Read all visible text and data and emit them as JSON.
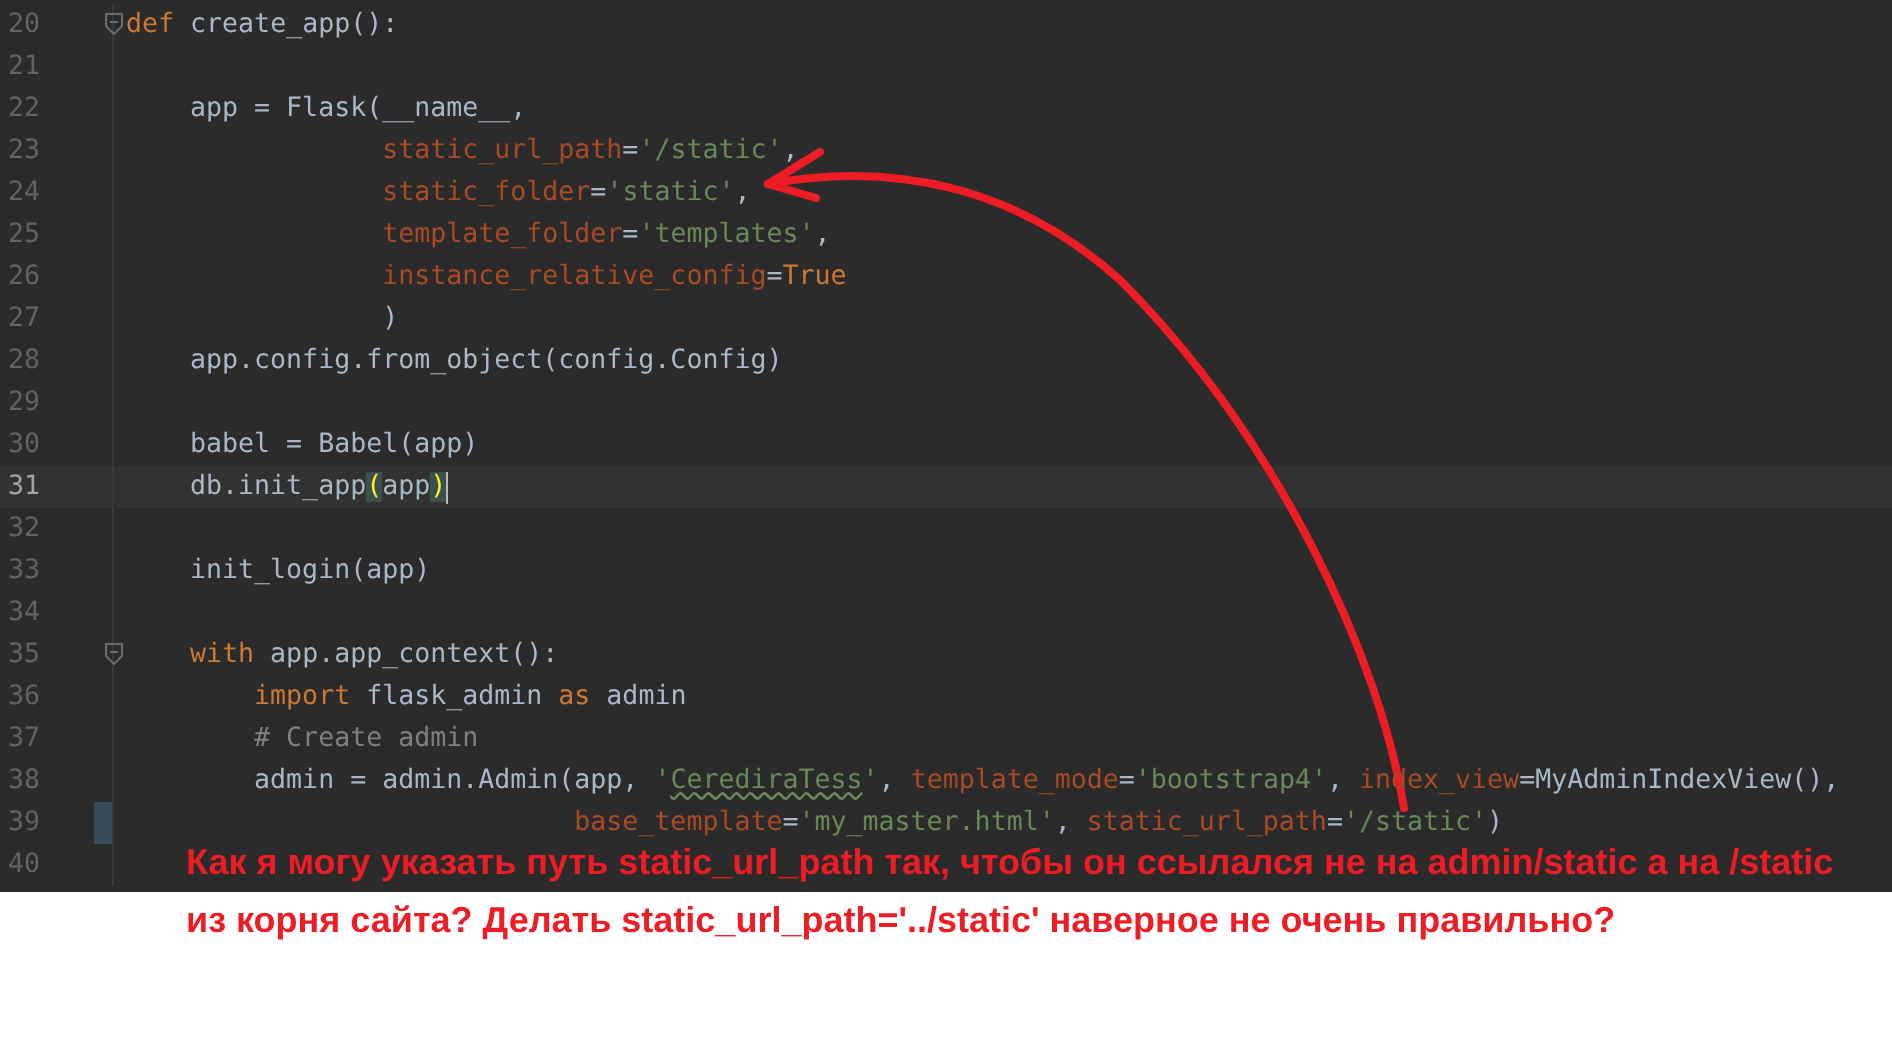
{
  "editor": {
    "lines": [
      {
        "number": "20",
        "fold": true,
        "current": false,
        "changed": false,
        "caret": false,
        "tokens": [
          {
            "text": "def",
            "kind": "keyword"
          },
          {
            "text": " create_app():",
            "kind": "plain"
          }
        ]
      },
      {
        "number": "21",
        "fold": false,
        "current": false,
        "changed": false,
        "caret": false
      },
      {
        "number": "22",
        "fold": false,
        "current": false,
        "changed": false,
        "caret": false,
        "tokens": [
          {
            "text": "    app = Flask(__name__,",
            "kind": "plain"
          }
        ]
      },
      {
        "number": "23",
        "fold": false,
        "current": false,
        "changed": false,
        "caret": false,
        "tokens": [
          {
            "text": "                static_url_path",
            "kind": "param"
          },
          {
            "text": "=",
            "kind": "plain"
          },
          {
            "text": "'/static'",
            "kind": "string"
          },
          {
            "text": ",",
            "kind": "plain"
          }
        ]
      },
      {
        "number": "24",
        "fold": false,
        "current": false,
        "changed": false,
        "caret": false,
        "tokens": [
          {
            "text": "                static_folder",
            "kind": "param"
          },
          {
            "text": "=",
            "kind": "plain"
          },
          {
            "text": "'static'",
            "kind": "string"
          },
          {
            "text": ",",
            "kind": "plain"
          }
        ]
      },
      {
        "number": "25",
        "fold": false,
        "current": false,
        "changed": false,
        "caret": false,
        "tokens": [
          {
            "text": "                template_folder",
            "kind": "param"
          },
          {
            "text": "=",
            "kind": "plain"
          },
          {
            "text": "'templates'",
            "kind": "string"
          },
          {
            "text": ",",
            "kind": "plain"
          }
        ]
      },
      {
        "number": "26",
        "fold": false,
        "current": false,
        "changed": false,
        "caret": false,
        "tokens": [
          {
            "text": "                instance_relative_config",
            "kind": "param"
          },
          {
            "text": "=",
            "kind": "plain"
          },
          {
            "text": "True",
            "kind": "keyword"
          }
        ]
      },
      {
        "number": "27",
        "fold": false,
        "current": false,
        "changed": false,
        "caret": false,
        "tokens": [
          {
            "text": "                )",
            "kind": "plain"
          }
        ]
      },
      {
        "number": "28",
        "fold": false,
        "current": false,
        "changed": false,
        "caret": false,
        "tokens": [
          {
            "text": "    app.config.from_object(config.Config)",
            "kind": "plain"
          }
        ]
      },
      {
        "number": "29",
        "fold": false,
        "current": false,
        "changed": false,
        "caret": false
      },
      {
        "number": "30",
        "fold": false,
        "current": false,
        "changed": false,
        "caret": false,
        "tokens": [
          {
            "text": "    babel = Babel(app)",
            "kind": "plain"
          }
        ]
      },
      {
        "number": "31",
        "fold": false,
        "current": true,
        "changed": false,
        "caret": true,
        "tokens": [
          {
            "text": "    db.init_app",
            "kind": "plain"
          },
          {
            "text": "(",
            "kind": "match"
          },
          {
            "text": "app",
            "kind": "plain"
          },
          {
            "text": ")",
            "kind": "match"
          }
        ]
      },
      {
        "number": "32",
        "fold": false,
        "current": false,
        "changed": false,
        "caret": false
      },
      {
        "number": "33",
        "fold": false,
        "current": false,
        "changed": false,
        "caret": false,
        "tokens": [
          {
            "text": "    init_login(app)",
            "kind": "plain"
          }
        ]
      },
      {
        "number": "34",
        "fold": false,
        "current": false,
        "changed": false,
        "caret": false
      },
      {
        "number": "35",
        "fold": true,
        "current": false,
        "changed": false,
        "caret": false,
        "tokens": [
          {
            "text": "    with",
            "kind": "keyword"
          },
          {
            "text": " app.app_context():",
            "kind": "plain"
          }
        ]
      },
      {
        "number": "36",
        "fold": false,
        "current": false,
        "changed": false,
        "caret": false,
        "tokens": [
          {
            "text": "        import",
            "kind": "keyword"
          },
          {
            "text": " flask_admin ",
            "kind": "plain"
          },
          {
            "text": "as",
            "kind": "keyword"
          },
          {
            "text": " admin",
            "kind": "plain"
          }
        ]
      },
      {
        "number": "37",
        "fold": false,
        "current": false,
        "changed": false,
        "caret": false,
        "tokens": [
          {
            "text": "        # Create admin",
            "kind": "comment"
          }
        ]
      },
      {
        "number": "38",
        "fold": false,
        "current": false,
        "changed": false,
        "caret": false,
        "tokens": [
          {
            "text": "        admin = admin.Admin(app, ",
            "kind": "plain"
          },
          {
            "text": "'",
            "kind": "string"
          },
          {
            "text": "CerediraTess",
            "kind": "typo"
          },
          {
            "text": "'",
            "kind": "string"
          },
          {
            "text": ", ",
            "kind": "plain"
          },
          {
            "text": "template_mode",
            "kind": "param"
          },
          {
            "text": "=",
            "kind": "plain"
          },
          {
            "text": "'bootstrap4'",
            "kind": "string"
          },
          {
            "text": ", ",
            "kind": "plain"
          },
          {
            "text": "index_view",
            "kind": "param"
          },
          {
            "text": "=MyAdminIndexView(),",
            "kind": "plain"
          }
        ]
      },
      {
        "number": "39",
        "fold": false,
        "current": false,
        "changed": true,
        "caret": false,
        "tokens": [
          {
            "text": "                            base_template",
            "kind": "param"
          },
          {
            "text": "=",
            "kind": "plain"
          },
          {
            "text": "'my_master.html'",
            "kind": "string"
          },
          {
            "text": ", ",
            "kind": "plain"
          },
          {
            "text": "static_url_path",
            "kind": "param"
          },
          {
            "text": "=",
            "kind": "plain"
          },
          {
            "text": "'/static'",
            "kind": "string"
          },
          {
            "text": ")",
            "kind": "plain"
          }
        ]
      },
      {
        "number": "40",
        "fold": false,
        "current": false,
        "changed": false,
        "caret": false
      }
    ]
  },
  "annotation": {
    "lines": [
      "Как я могу указать путь static_url_path так, чтобы он ссылался не на admin/static а на /static",
      "из корня сайта? Делать static_url_path='../static' наверное не очень правильно?"
    ]
  }
}
